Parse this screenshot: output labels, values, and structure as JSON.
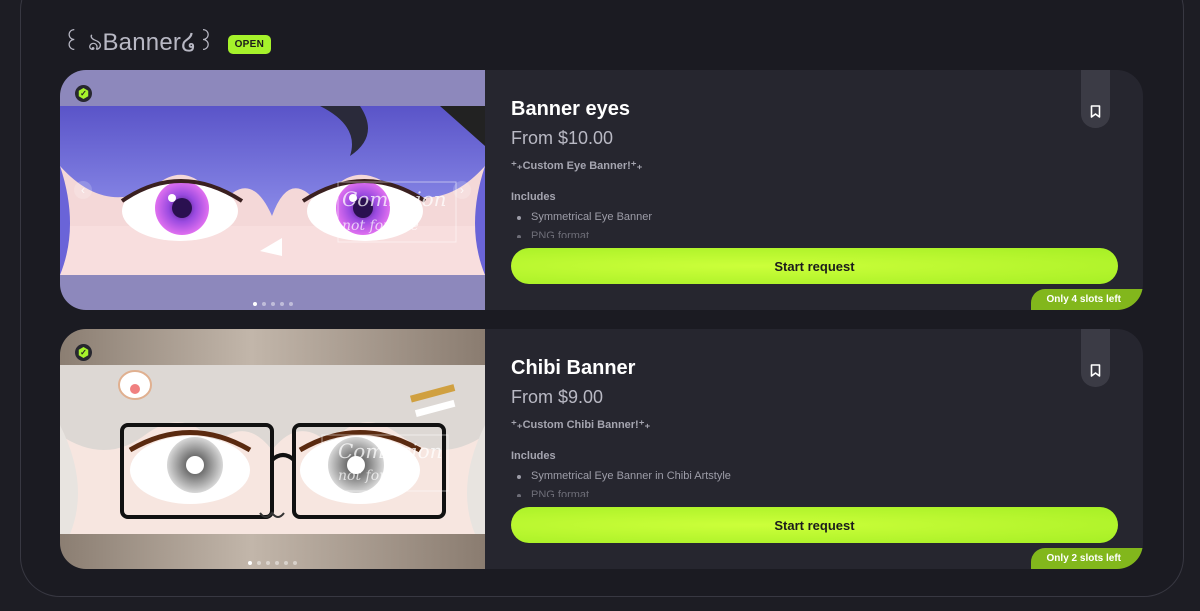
{
  "header": {
    "title": "꒰ ঌBanner໒꒱",
    "status_badge": "OPEN"
  },
  "colors": {
    "accent": "#a6f22b",
    "background": "#1d1d24",
    "card": "#26262f"
  },
  "cards": [
    {
      "title": "Banner eyes",
      "price": "From $10.00",
      "tagline": "⁺₊Custom Eye Banner!⁺₊",
      "includes_label": "Includes",
      "includes": [
        "Symmetrical Eye Banner",
        "PNG format"
      ],
      "button_label": "Start request",
      "slots_label": "Only 4 slots left",
      "image_count": 5,
      "active_image": 1,
      "image_icon": "anime-eyes-purple-image"
    },
    {
      "title": "Chibi Banner",
      "price": "From $9.00",
      "tagline": "⁺₊Custom Chibi Banner!⁺₊",
      "includes_label": "Includes",
      "includes": [
        "Symmetrical Eye Banner in Chibi Artstyle",
        "PNG format"
      ],
      "button_label": "Start request",
      "slots_label": "Only 2 slots left",
      "image_count": 6,
      "active_image": 1,
      "image_icon": "anime-eyes-white-hair-glasses-image"
    }
  ]
}
